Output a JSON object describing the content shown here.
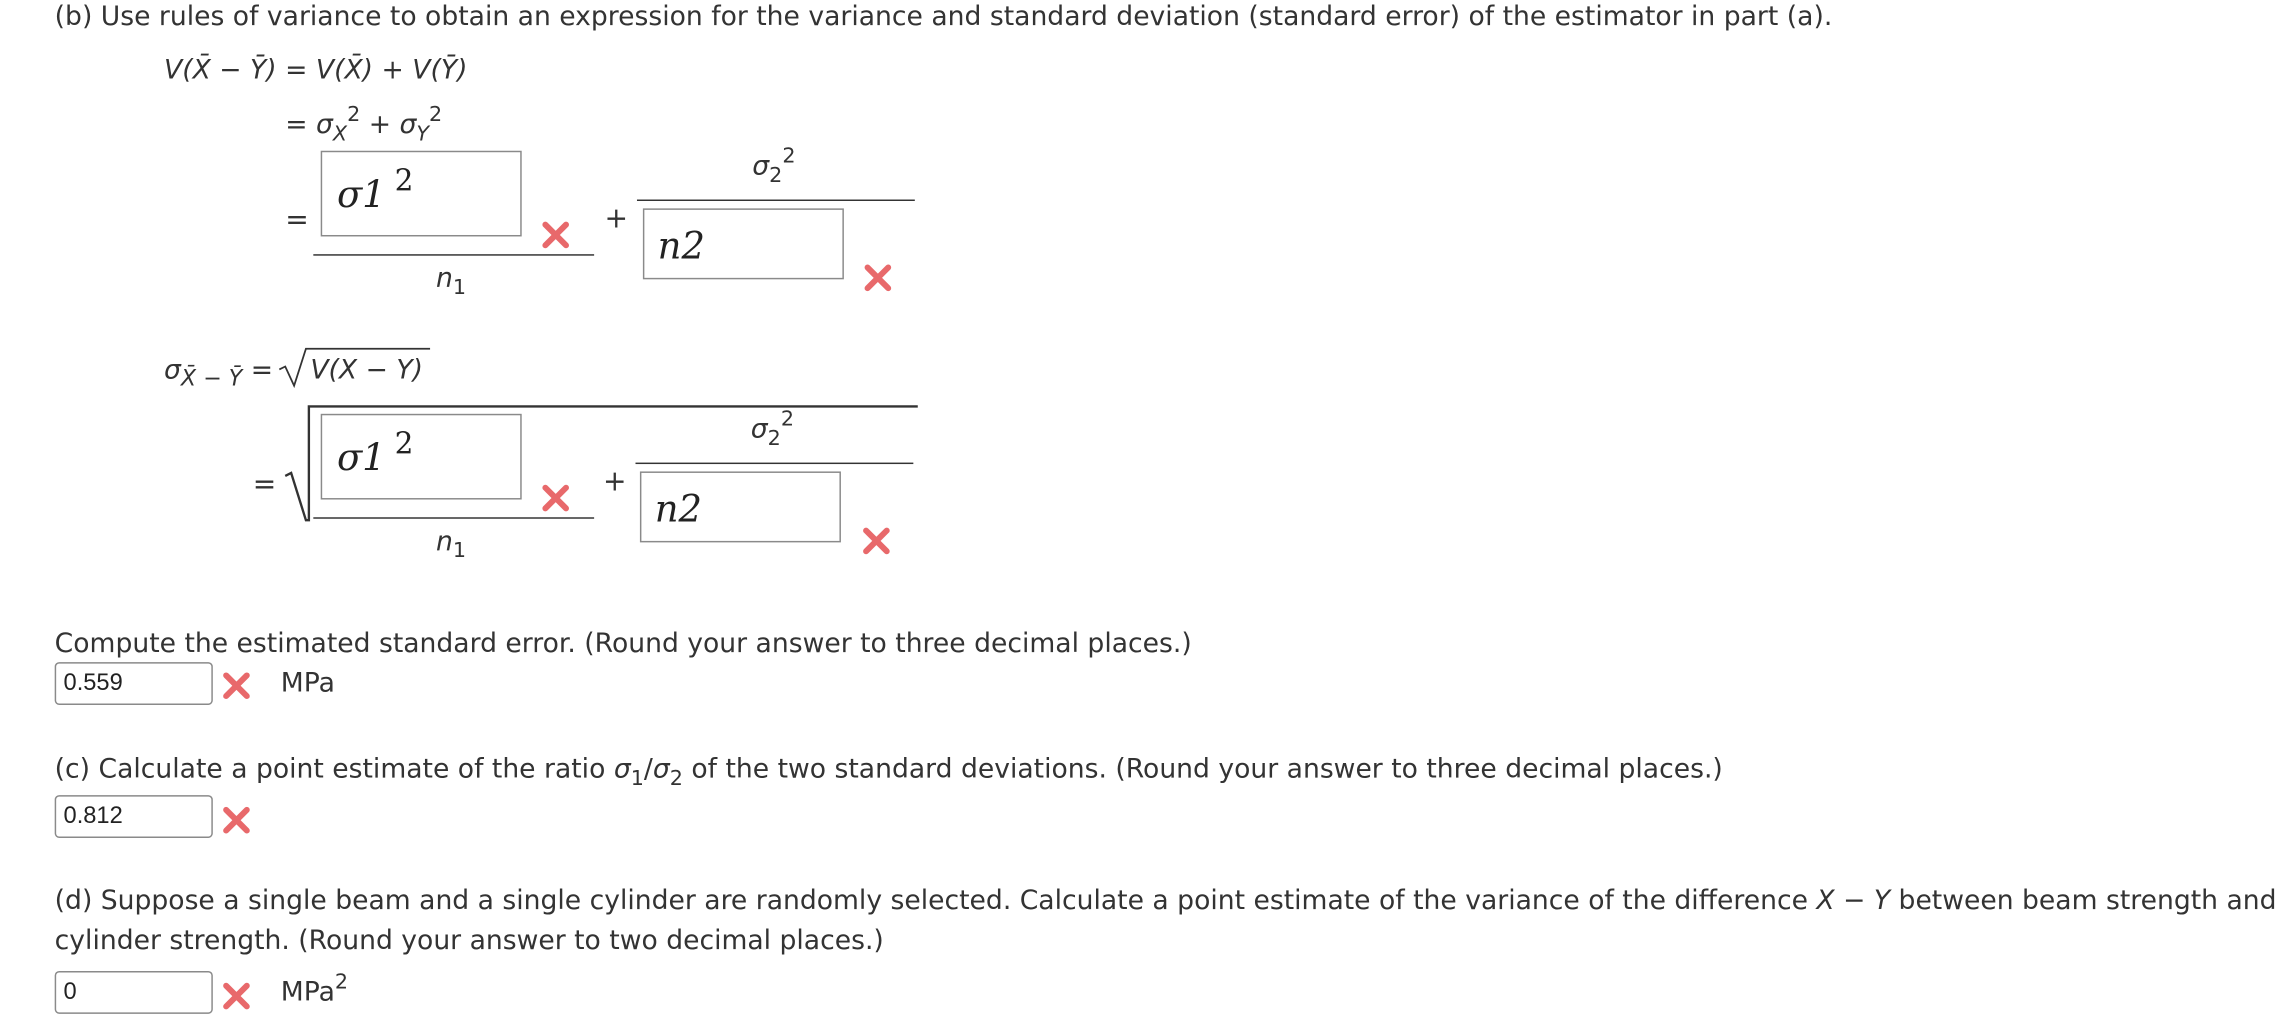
{
  "part_b": {
    "prompt": "(b) Use rules of variance to obtain an expression for the variance and standard deviation (standard error) of the estimator in part (a).",
    "variance_lhs": "V(X̄ − Ȳ) = V(X̄) + V(Ȳ)",
    "variance_line2": {
      "eq": "=",
      "sigma": "σ",
      "x_sub": "X",
      "y_sub": "Y",
      "sq": "2",
      "plus": "+"
    },
    "variance_line3": {
      "eq": "=",
      "plus": "+",
      "box1": {
        "value": "σ1",
        "sup": "2",
        "status": "incorrect"
      },
      "den1": {
        "var": "n",
        "sub": "1"
      },
      "num2": {
        "var": "σ",
        "sub": "2",
        "sup": "2"
      },
      "box2": {
        "value": "n2",
        "status": "incorrect"
      }
    },
    "std_lhs": {
      "sigma": "σ",
      "sub": "X̄ − Ȳ",
      "eq": "=",
      "radicand": "V(X − Y)"
    },
    "std_line2": {
      "eq": "=",
      "plus": "+",
      "box1": {
        "value": "σ1",
        "sup": "2",
        "status": "incorrect"
      },
      "den1": {
        "var": "n",
        "sub": "1"
      },
      "num2": {
        "var": "σ",
        "sub": "2",
        "sup": "2"
      },
      "box2": {
        "value": "n2",
        "status": "incorrect"
      }
    },
    "compute_prompt": "Compute the estimated standard error. (Round your answer to three decimal places.)",
    "compute_answer": "0.559",
    "compute_unit": "MPa",
    "compute_status": "incorrect"
  },
  "part_c": {
    "prompt_before": "(c) Calculate a point estimate of the ratio ",
    "ratio": {
      "sigma": "σ",
      "sub1": "1",
      "slash": "/",
      "sub2": "2"
    },
    "prompt_after": " of the two standard deviations. (Round your answer to three decimal places.)",
    "answer": "0.812",
    "status": "incorrect"
  },
  "part_d": {
    "prompt_line1_before": "(d) Suppose a single beam and a single cylinder are randomly selected. Calculate a point estimate of the variance of the difference ",
    "expr": "X − Y",
    "prompt_line1_after": " between beam strength and",
    "prompt_line2": "cylinder strength. (Round your answer to two decimal places.)",
    "answer": "0",
    "unit": "MPa",
    "unit_sup": "2",
    "status": "incorrect"
  },
  "colors": {
    "incorrect": "#e8696b",
    "text": "#333333",
    "border": "#8a8a8a"
  },
  "icons": {
    "status_incorrect": "x-mark-icon"
  }
}
